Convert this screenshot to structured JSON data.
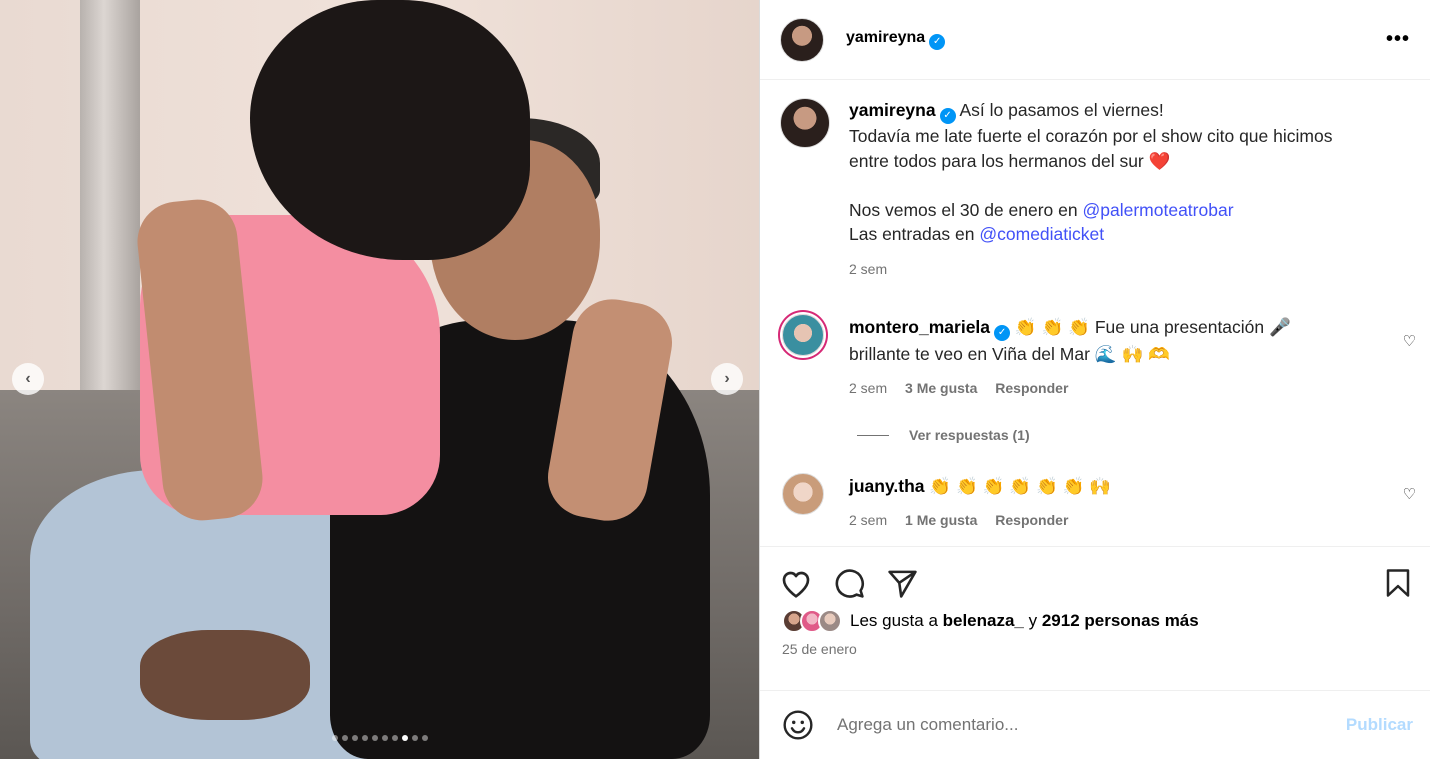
{
  "post": {
    "username": "yamireyna",
    "more_label": "•••",
    "caption": {
      "username": "yamireyna",
      "line1": "Así lo pasamos el viernes!",
      "line2": "Todavía me late fuerte el corazón por el show cito que hicimos",
      "line3": "entre todos para los hermanos del sur ❤️",
      "line4_prefix": "Nos vemos el 30 de enero en ",
      "line4_mention": "@palermoteatrobar",
      "line5_prefix": "Las entradas en ",
      "line5_mention": "@comediaticket",
      "time": "2 sem"
    },
    "comments": [
      {
        "username": "montero_mariela",
        "text_line1": "👏 👏 👏 Fue una presentación 🎤",
        "text_line2": "brillante te veo en Viña del Mar 🌊 🙌 🫶",
        "time": "2 sem",
        "likes": "3 Me gusta",
        "reply": "Responder",
        "view_replies": "Ver respuestas (1)"
      },
      {
        "username": "juany.tha",
        "text_line1": "👏 👏 👏 👏 👏 👏 🙌",
        "time": "2 sem",
        "likes": "1 Me gusta",
        "reply": "Responder"
      }
    ],
    "likes": {
      "prefix": "Les gusta a ",
      "user": "belenaza_",
      "middle": " y ",
      "count": "2912 personas más"
    },
    "date": "25 de enero",
    "comment_box": {
      "placeholder": "Agrega un comentario...",
      "publish": "Publicar"
    }
  },
  "carousel": {
    "total": 10,
    "active_index": 7
  },
  "colors": {
    "accent": "#0095f6",
    "mention": "#4150f7",
    "publish_disabled": "#b3dbff"
  },
  "icons": [
    "heart-icon",
    "comment-icon",
    "share-icon",
    "bookmark-icon",
    "emoji-icon",
    "verified-icon",
    "chevron-left-icon",
    "chevron-right-icon",
    "more-icon"
  ]
}
